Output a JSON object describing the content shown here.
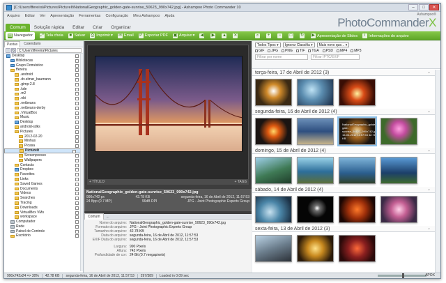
{
  "window": {
    "title": "[C:\\Users\\ffereira\\Pictures\\PictureIt\\NationalGeographic_golden-gate-sunrise_50623_990x742.jpg] - Ashampoo Photo Commander 10",
    "minimize": "–",
    "maximize": "□",
    "close": "✕"
  },
  "menu": [
    "Arquivo",
    "Editar",
    "Ver",
    "Apresentação",
    "Ferramentas",
    "Configuração",
    "Meu Ashampoo",
    "Ajuda"
  ],
  "brand": {
    "small": "Ashampoo®",
    "name": "PhotoCommander",
    "x": "X"
  },
  "tabs": [
    {
      "label": "Comum"
    },
    {
      "label": "Solução rápida"
    },
    {
      "label": "Editar"
    },
    {
      "label": "Criar"
    },
    {
      "label": "Organizar"
    }
  ],
  "toolbar": [
    {
      "label": "Navegador",
      "icon": "navigator-icon"
    },
    {
      "label": "Tela cheia",
      "icon": "fullscreen-icon"
    },
    {
      "label": "Salvar",
      "icon": "save-icon"
    },
    {
      "label": "Imprimir",
      "icon": "print-icon"
    },
    {
      "label": "Email",
      "icon": "email-icon"
    },
    {
      "label": "Exportar PDF",
      "icon": "pdf-icon"
    },
    {
      "label": "Arquivo",
      "icon": "file-icon"
    }
  ],
  "toolbar_right": [
    {
      "label": "Apresentação de Slides",
      "icon": "slideshow-icon"
    },
    {
      "label": "Informações do arquivo",
      "icon": "info-icon"
    }
  ],
  "left_panel": {
    "tabs": [
      "Pastas",
      "Calendário"
    ],
    "path": "C:\\Users\\ffereira\\Pictures",
    "tree": [
      {
        "label": "Desktop",
        "indent": 0,
        "type": "blue"
      },
      {
        "label": "Bibliotecas",
        "indent": 1,
        "type": "blue"
      },
      {
        "label": "Grupo Doméstico",
        "indent": 1,
        "type": "blue"
      },
      {
        "label": "ffereira",
        "indent": 1,
        "type": "yellow"
      },
      {
        "label": ".android",
        "indent": 2,
        "type": "yellow"
      },
      {
        "label": ".dv.elmar_baumann",
        "indent": 2,
        "type": "yellow"
      },
      {
        "label": ".gimp-2.8",
        "indent": 2,
        "type": "yellow"
      },
      {
        "label": ".kde",
        "indent": 2,
        "type": "yellow"
      },
      {
        "label": ".m2",
        "indent": 2,
        "type": "yellow"
      },
      {
        "label": ".nbi",
        "indent": 2,
        "type": "yellow"
      },
      {
        "label": ".netbeans",
        "indent": 2,
        "type": "yellow"
      },
      {
        "label": ".netbeans-derby",
        "indent": 2,
        "type": "yellow"
      },
      {
        "label": ".VirtualBox",
        "indent": 2,
        "type": "yellow"
      },
      {
        "label": "Music",
        "indent": 2,
        "type": "yellow"
      },
      {
        "label": "Desktop",
        "indent": 2,
        "type": "blue"
      },
      {
        "label": "android-sdks",
        "indent": 2,
        "type": "yellow"
      },
      {
        "label": "Pictures",
        "indent": 2,
        "type": "yellow"
      },
      {
        "label": "2012-02-20",
        "indent": 3,
        "type": "yellow"
      },
      {
        "label": "Minhas",
        "indent": 3,
        "type": "yellow"
      },
      {
        "label": "Picasa",
        "indent": 3,
        "type": "yellow"
      },
      {
        "label": "PictureIt",
        "indent": 3,
        "type": "yellow",
        "selected": true
      },
      {
        "label": "Screenpresso",
        "indent": 3,
        "type": "yellow"
      },
      {
        "label": "Wallpapers",
        "indent": 3,
        "type": "yellow"
      },
      {
        "label": "Contacts",
        "indent": 2,
        "type": "yellow"
      },
      {
        "label": "Dropbox",
        "indent": 2,
        "type": "blue"
      },
      {
        "label": "Favorites",
        "indent": 2,
        "type": "yellow"
      },
      {
        "label": "Links",
        "indent": 2,
        "type": "yellow"
      },
      {
        "label": "Saved Games",
        "indent": 2,
        "type": "yellow"
      },
      {
        "label": "Documents",
        "indent": 2,
        "type": "yellow"
      },
      {
        "label": "Videos",
        "indent": 2,
        "type": "yellow"
      },
      {
        "label": "Searches",
        "indent": 2,
        "type": "yellow"
      },
      {
        "label": "Tracing",
        "indent": 2,
        "type": "yellow"
      },
      {
        "label": "Downloads",
        "indent": 2,
        "type": "yellow"
      },
      {
        "label": "VirtualBox VMs",
        "indent": 2,
        "type": "yellow"
      },
      {
        "label": "workspace",
        "indent": 2,
        "type": "yellow"
      },
      {
        "label": "Computador",
        "indent": 1,
        "type": "gray"
      },
      {
        "label": "Rede",
        "indent": 1,
        "type": "gray"
      },
      {
        "label": "Painel de Controle",
        "indent": 1,
        "type": "gray"
      },
      {
        "label": "Escritório",
        "indent": 1,
        "type": "yellow"
      }
    ]
  },
  "preview": {
    "left_label": "+ TÍTULO",
    "right_label": "+ TAGS",
    "filename": "NationalGeographic_golden-gate-sunrise_50623_990x742.jpg",
    "info_left": [
      "990x742 px",
      "24 Bpp (0.7 MP)"
    ],
    "info_mid": [
      "42.78 KB",
      "96dB DPI"
    ],
    "info_right": [
      "segunda-feira, 16 de Abril de 2012, 11:57:53",
      "JPG - Joint Photographic Experts Group"
    ]
  },
  "exif": {
    "tabs": [
      "Comum",
      "..."
    ],
    "rows": [
      {
        "k": "Nome do arquivo:",
        "v": "NationalGeographic_golden-gate-sunrise_50623_990x742.jpg"
      },
      {
        "k": "Formato do arquivo:",
        "v": "JPG - Joint Photographic Experts Group"
      },
      {
        "k": "Tamanho do arquivo:",
        "v": "42.78 KB"
      },
      {
        "k": "Data do arquivo:",
        "v": "segunda-feira, 16 de Abril de 2012, 11:57:53"
      },
      {
        "k": "EXIF Data do arquivo:",
        "v": "segunda-feira, 16 de Abril de 2012, 11:57:53"
      }
    ],
    "rows2": [
      {
        "k": "Largura:",
        "v": "990 Pixels"
      },
      {
        "k": "Altura:",
        "v": "742 Pixels"
      },
      {
        "k": "Profundidade de cor:",
        "v": "24 Bit (0.7 megapixels)"
      }
    ]
  },
  "filters": {
    "type": "Todos Tipos",
    "ignore": "Ignorar Classifia",
    "more": "Mais novo que...",
    "formats": [
      "GIF",
      "JPG",
      "PNG",
      "TIF",
      "TGA",
      "PSD",
      "MP4",
      "MP3"
    ],
    "filter_iptc": "Filtrar por nome",
    "filter_exif": "Filtrar IPTC/EXIF"
  },
  "groups": [
    {
      "title": "terça-feira, 17 de Abril de 2012 (3)",
      "thumbs": [
        "c1",
        "c2",
        "c3"
      ]
    },
    {
      "title": "segunda-feira, 16 de Abril de 2012 (4)",
      "thumbs": [
        "c4",
        "c5",
        "c6",
        "c8"
      ],
      "selected_index": 2,
      "selected_caption": "NationalGeographic_golden-gate-sunrise_50623_990x742.jpg 16-04-2012 11:57:53 42.78 KB"
    },
    {
      "title": "domingo, 15 de Abril de 2012 (4)",
      "thumbs": [
        "c9",
        "c10",
        "c11",
        "c12"
      ]
    },
    {
      "title": "sábado, 14 de Abril de 2012 (4)",
      "thumbs": [
        "c13",
        "c14",
        "c15",
        "c16"
      ]
    },
    {
      "title": "sexta-feira, 13 de Abril de 2012 (3)",
      "thumbs": [
        "c17",
        "c18",
        "c19"
      ]
    }
  ],
  "status": {
    "dims": "990x742x24 => 30%",
    "size": "42.78 KB",
    "date": "segunda-feira, 16 de Abril de 2012, 11:57:53",
    "count": "297/389",
    "loaded": "Loaded in 0.09 sec",
    "zoom": "APOX"
  }
}
